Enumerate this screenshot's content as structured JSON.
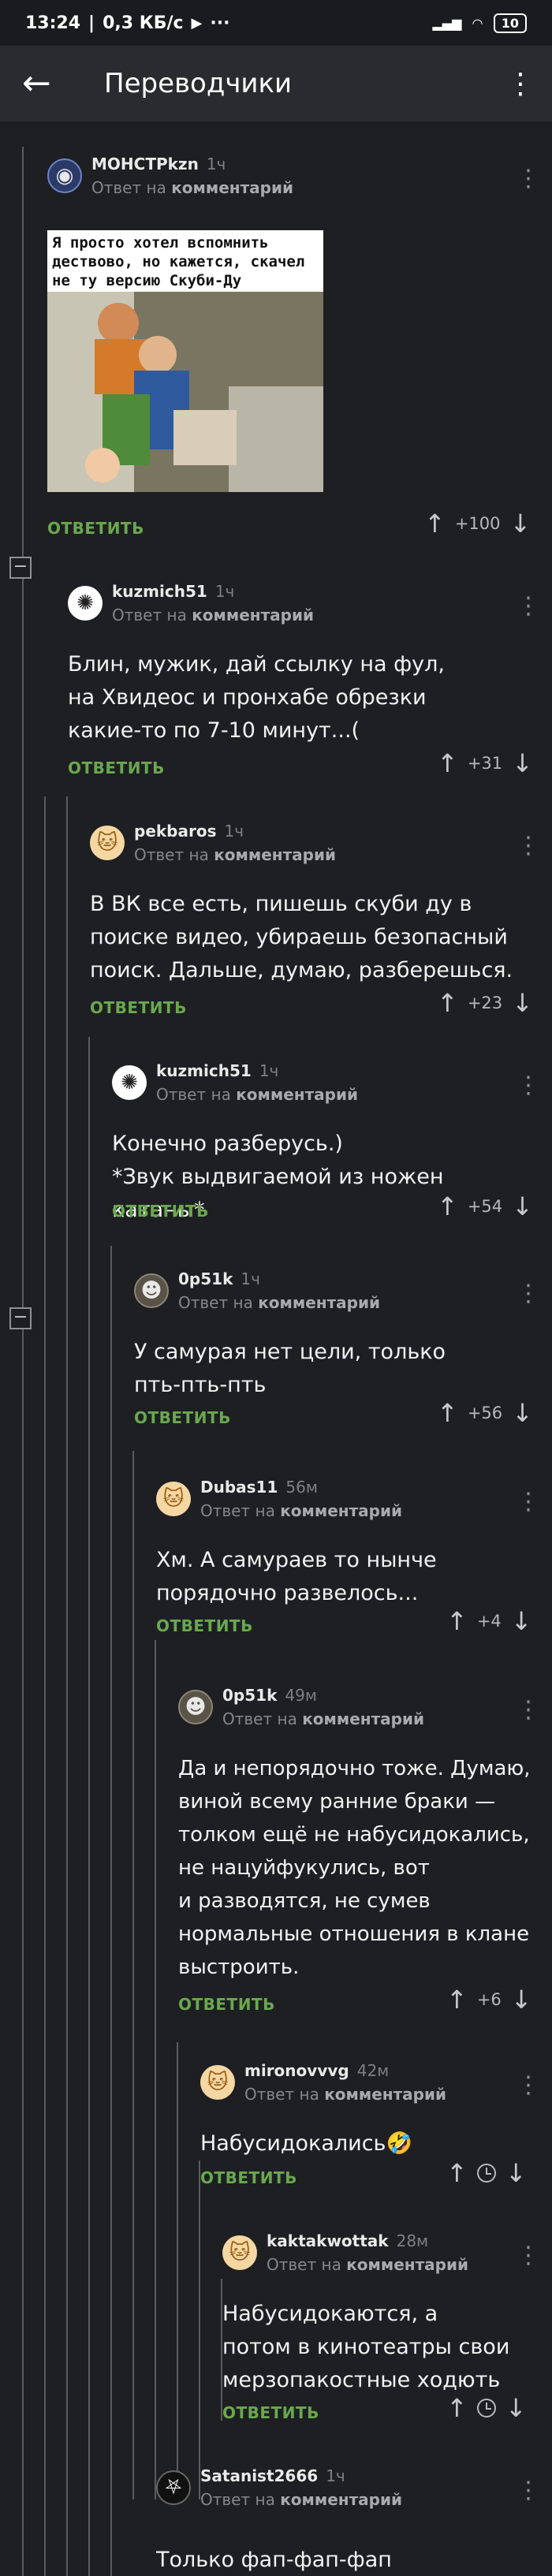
{
  "status_bar": {
    "time": "13:24",
    "speed": "0,3 КБ/с",
    "battery": "10"
  },
  "app_bar": {
    "title": "Переводчики"
  },
  "reply_to_prefix": "Ответ на",
  "reply_to_target": "комментарий",
  "reply_label": "ОТВЕТИТЬ",
  "comments": [
    {
      "user": "МОНСТРkzn",
      "time": "1ч",
      "text": "",
      "rating": "+100",
      "meme_caption": "Я просто хотел вспомнить дествово, но кажется, скачел не ту версию Скуби-Ду"
    },
    {
      "user": "kuzmich51",
      "time": "1ч",
      "text": "Блин, мужик, дай ссылку на фул, на Хвидеос и пронхабе обрезки какие-то по 7-10 минут...(",
      "rating": "+31"
    },
    {
      "user": "pekbaros",
      "time": "1ч",
      "text": "В ВК все есть, пишешь скуби ду в поиске видео, убираешь безопасный поиск. Дальше, думаю, разберешься.",
      "rating": "+23"
    },
    {
      "user": "kuzmich51",
      "time": "1ч",
      "text": "Конечно разберусь.)\n*Звук выдвигаемой из ножен катаны*",
      "rating": "+54"
    },
    {
      "user": "0p51k",
      "time": "1ч",
      "text": "У самурая нет цели, только\nпть-пть-пть",
      "rating": "+56"
    },
    {
      "user": "Dubas11",
      "time": "56м",
      "text": "Хм. А самураев то нынче\nпорядочно развелось...",
      "rating": "+4"
    },
    {
      "user": "0p51k",
      "time": "49м",
      "text": "Да и непорядочно тоже. Думаю,\nвиной всему ранние браки —\nтолком ещё не набусидокались,\nне нацуйфукулись, вот\nи разводятся, не сумев\nнормальные отношения в клане\nвыстроить.",
      "rating": "+6"
    },
    {
      "user": "mironovvvg",
      "time": "42м",
      "text": "Набусидокались🤣",
      "rating": ""
    },
    {
      "user": "kaktakwottak",
      "time": "28м",
      "text": "Набусидокаются, а\nпотом в кинотеатры свои\nмерзопакостные ходють",
      "rating": ""
    },
    {
      "user": "Satanist2666",
      "time": "1ч",
      "text": "Только фап-фап-фап",
      "rating": ""
    }
  ]
}
